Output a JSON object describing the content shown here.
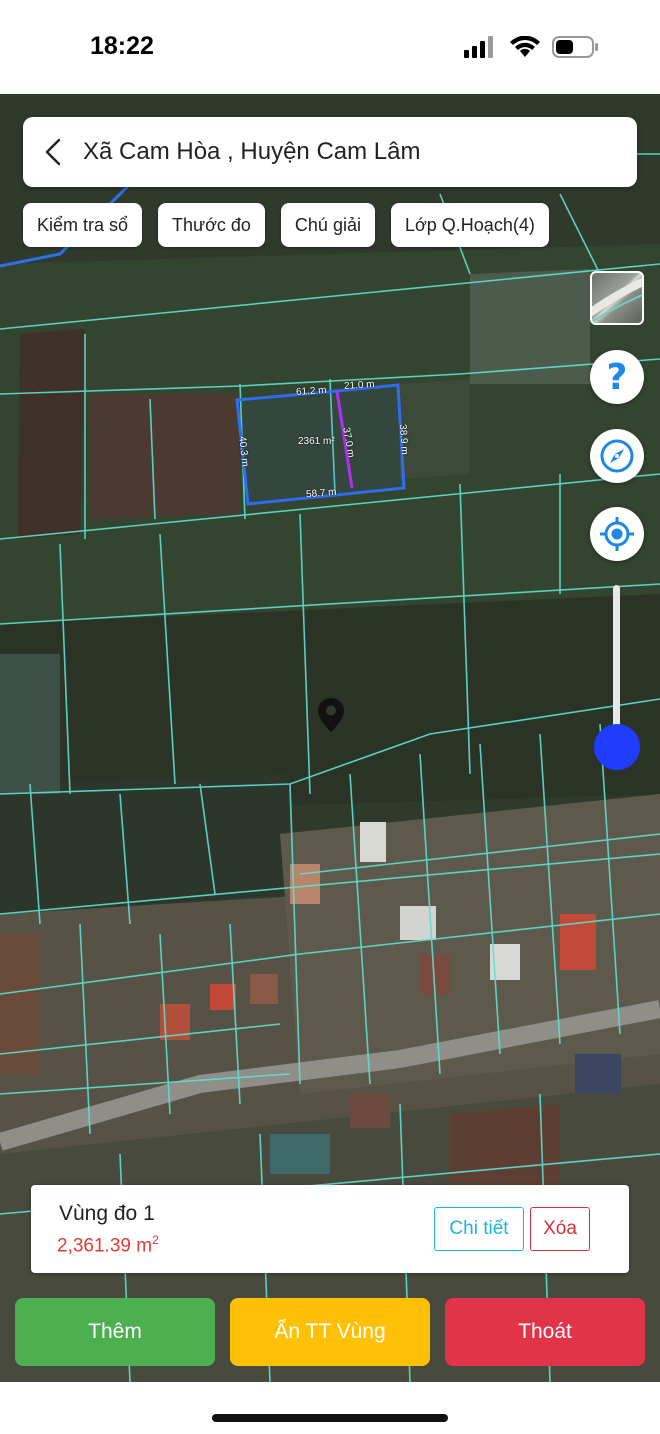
{
  "status_bar": {
    "time": "18:22",
    "icons": [
      "cellular-signal-icon",
      "wifi-icon",
      "battery-icon"
    ]
  },
  "search": {
    "title": "Xã Cam Hòa , Huyện Cam Lâm",
    "back_icon": "chevron-left-icon"
  },
  "toolbar": {
    "chips": [
      {
        "label": "Kiểm tra sổ"
      },
      {
        "label": "Thước đo"
      },
      {
        "label": "Chú giải"
      },
      {
        "label": "Lớp Q.Hoạch(4)"
      }
    ]
  },
  "map": {
    "measurements": {
      "top_left": "61.2 m",
      "top_right": "21.0 m",
      "left": "40.3 m",
      "right": "38.9 m",
      "bottom": "58.7 m",
      "middle": "37.0 m",
      "area": "2361 m²"
    },
    "icons": [
      "location-pin-icon"
    ]
  },
  "controls": {
    "help_glyph": "?",
    "zoom_level": 0.1,
    "icons": [
      "layer-thumbnail",
      "help-icon",
      "compass-icon",
      "my-location-icon"
    ]
  },
  "info_card": {
    "name": "Vùng đo 1",
    "area_value": "2,361.39 m",
    "area_unit_sup": "2",
    "detail_label": "Chi tiết",
    "delete_label": "Xóa"
  },
  "actions": {
    "add_label": "Thêm",
    "hide_label": "Ẩn TT Vùng",
    "exit_label": "Thoát"
  },
  "colors": {
    "add": "#4caf50",
    "hide": "#ffc107",
    "exit": "#e23448",
    "accent": "#1e88e5",
    "parcel_line": "#5ee0d0"
  }
}
